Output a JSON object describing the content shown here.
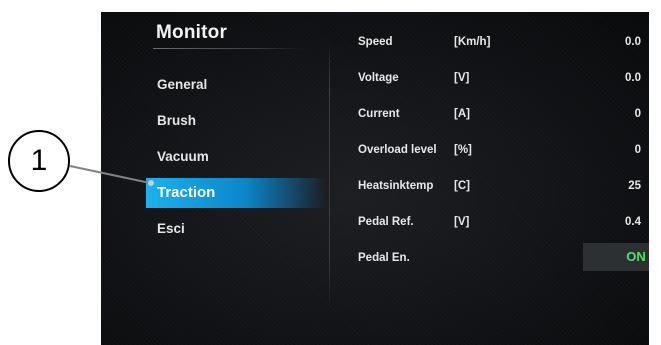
{
  "screen": {
    "title": "Monitor"
  },
  "menu": {
    "items": [
      {
        "label": "General",
        "active": false
      },
      {
        "label": "Brush",
        "active": false
      },
      {
        "label": "Vacuum",
        "active": false
      },
      {
        "label": "Traction",
        "active": true
      },
      {
        "label": "Esci",
        "active": false
      }
    ]
  },
  "rows": [
    {
      "label": "Speed",
      "unit": "[Km/h]",
      "value": "0.0"
    },
    {
      "label": "Voltage",
      "unit": "[V]",
      "value": "0.0"
    },
    {
      "label": "Current",
      "unit": "[A]",
      "value": "0"
    },
    {
      "label": "Overload level",
      "unit": "[%]",
      "value": "0"
    },
    {
      "label": "Heatsinktemp",
      "unit": "[C]",
      "value": "25"
    },
    {
      "label": "Pedal Ref.",
      "unit": "[V]",
      "value": "0.4"
    },
    {
      "label": "Pedal En.",
      "toggle": "ON"
    }
  ],
  "callout": {
    "number": "1"
  },
  "colors": {
    "accent": "#0b86c9",
    "toggle_on": "#53e06a",
    "screen_bg": "#111215"
  }
}
